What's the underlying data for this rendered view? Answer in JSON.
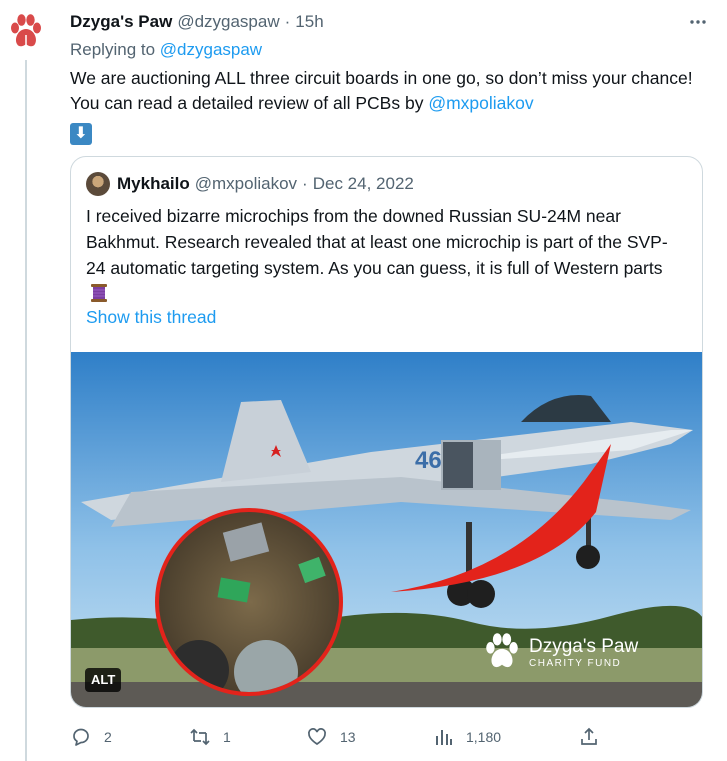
{
  "tweet": {
    "display_name": "Dzyga's Paw",
    "handle": "@dzygaspaw",
    "dot": "·",
    "time": "15h",
    "more_icon": "more-horizontal-icon",
    "reply_prefix": "Replying to ",
    "reply_to": "@dzygaspaw",
    "text_part1": "We are auctioning ALL three circuit boards in one go, so don’t miss your chance! You can read a detailed review of all PCBs by ",
    "text_mention": "@mxpoliakov",
    "text_emoji": "⬇"
  },
  "quote": {
    "display_name": "Mykhailo",
    "handle": "@mxpoliakov",
    "dot": "·",
    "date": "Dec 24, 2022",
    "text": "I received bizarre microchips from the downed Russian SU-24M near Bakhmut. Research revealed that at least one microchip is part of the SVP-24 automatic targeting system. As you can guess, it is full of Western parts",
    "show_thread": "Show this thread",
    "media": {
      "alt_badge": "ALT",
      "tail_number": "46",
      "watermark_title": "Dzyga's Paw",
      "watermark_subtitle": "CHARITY FUND"
    }
  },
  "actions": {
    "reply_count": "2",
    "retweet_count": "1",
    "like_count": "13",
    "views_count": "1,180"
  },
  "colors": {
    "link": "#1d9bf0",
    "muted": "#536471",
    "text": "#0f1419",
    "border": "#cfd9de"
  }
}
